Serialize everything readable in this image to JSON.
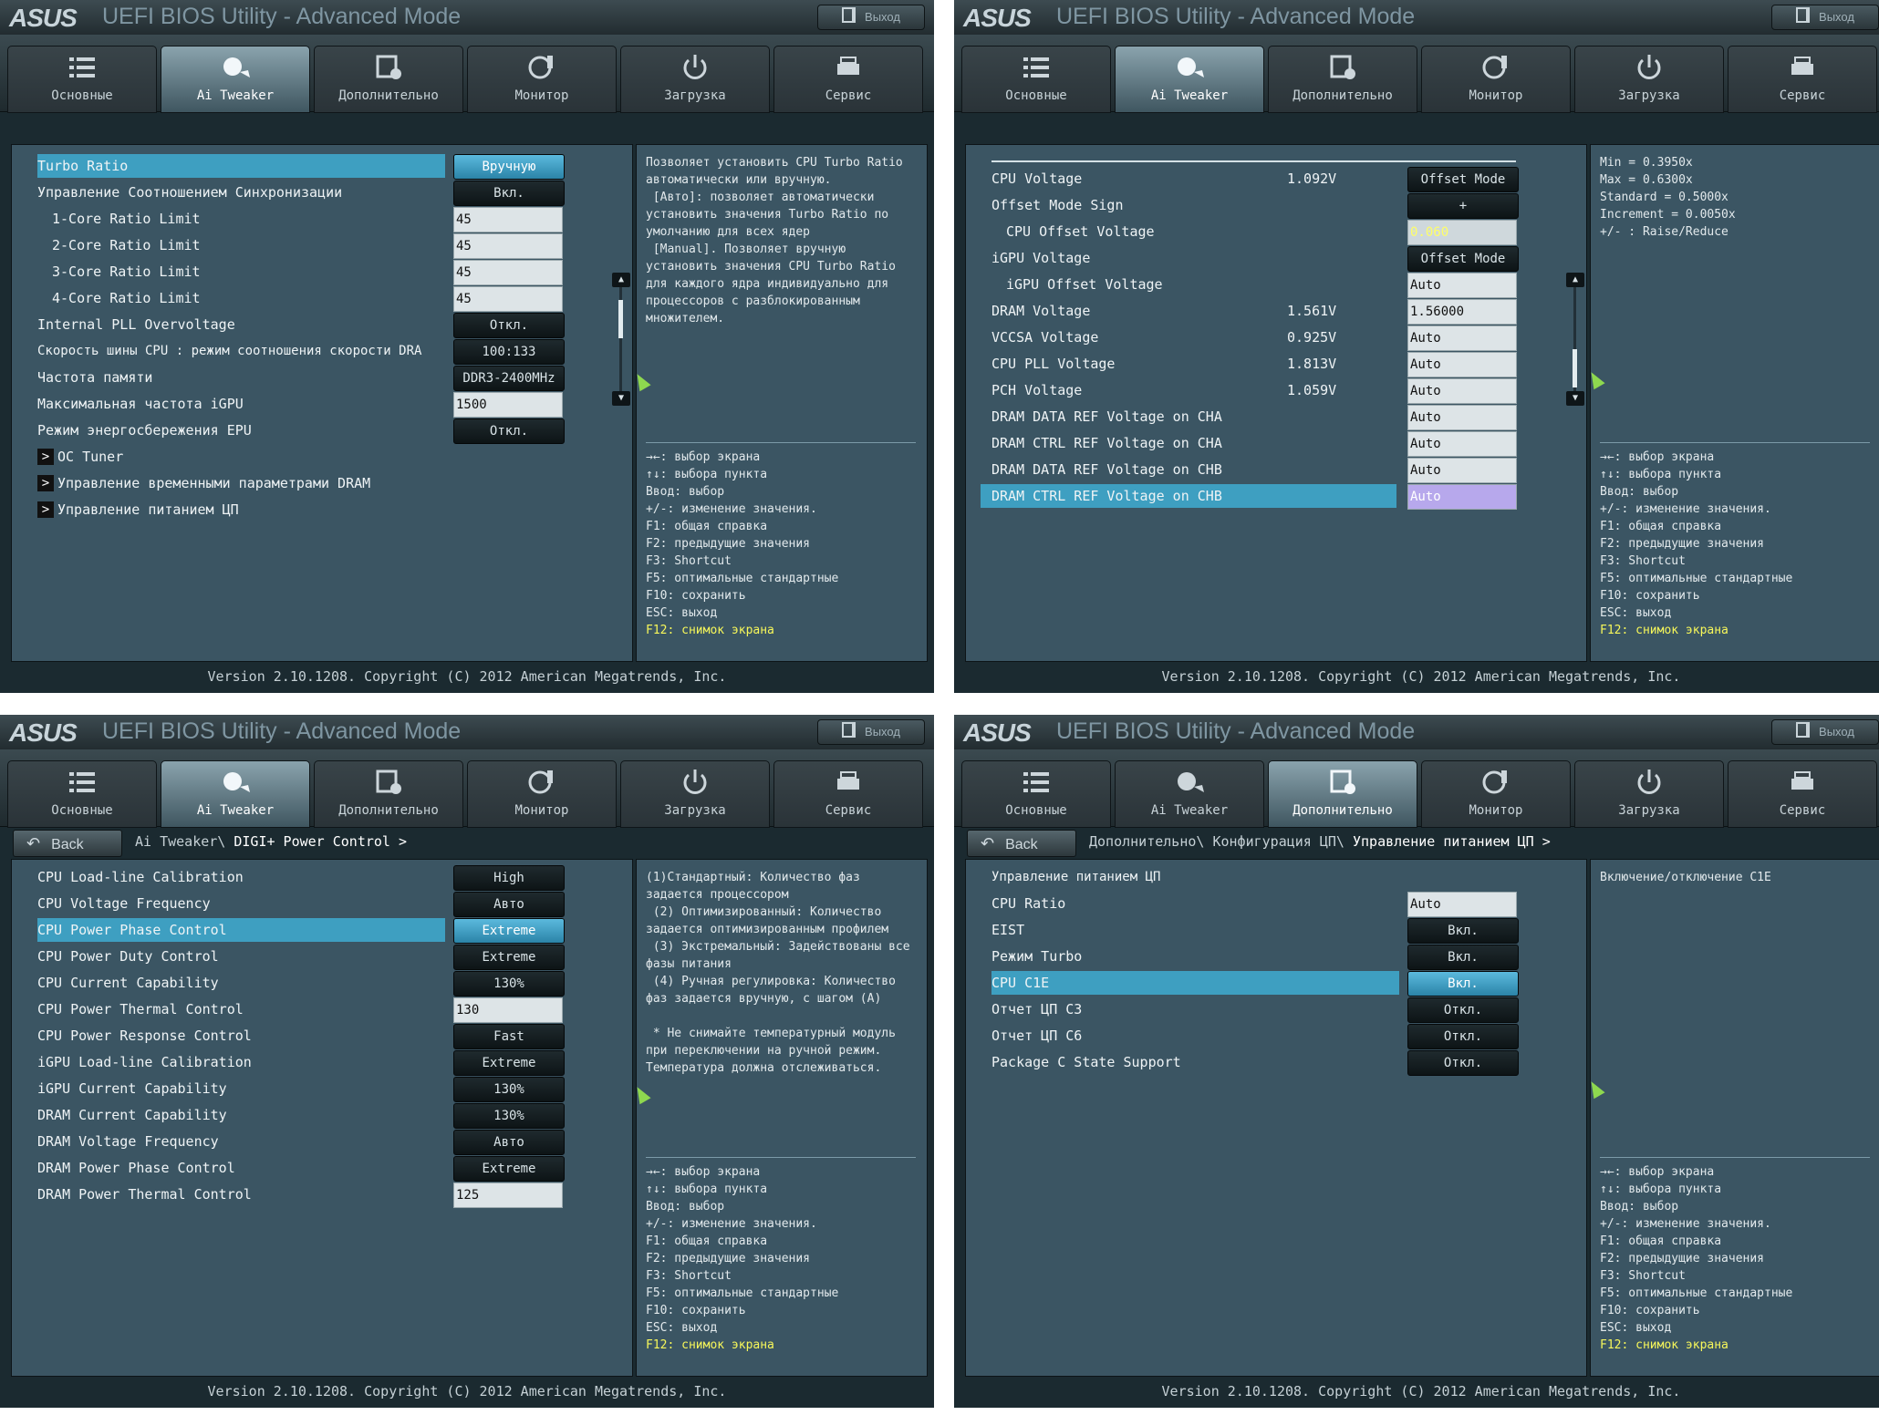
{
  "app": {
    "logo": "ASUS",
    "title": "UEFI BIOS Utility - Advanced Mode",
    "exit_label": "Выход",
    "footer": "Version 2.10.1208. Copyright (C) 2012 American Megatrends, Inc.",
    "back_label": "Back"
  },
  "tabs": [
    {
      "label": "Основные",
      "icon": "list-icon"
    },
    {
      "label": "Ai Tweaker",
      "icon": "fan-icon"
    },
    {
      "label": "Дополнительно",
      "icon": "settings-page-icon"
    },
    {
      "label": "Монитор",
      "icon": "gauge-icon"
    },
    {
      "label": "Загрузка",
      "icon": "power-icon"
    },
    {
      "label": "Сервис",
      "icon": "printer-icon"
    }
  ],
  "keys": [
    "→←: выбор экрана",
    "↑↓: выбора пункта",
    "Ввод: выбор",
    "+/-: изменение значения.",
    "F1: общая справка",
    "F2: предыдущие значения",
    "F3: Shortcut",
    "F5: оптимальные стандартные",
    "F10: сохранить",
    "ESC: выход",
    "F12: снимок экрана"
  ],
  "panel1": {
    "rows": [
      {
        "label": "Turbo Ratio",
        "value": "Вручную"
      },
      {
        "label": "Управление Соотношением Синхронизации",
        "value": "Вкл."
      },
      {
        "label": "1-Core Ratio Limit",
        "value": "45"
      },
      {
        "label": "2-Core Ratio Limit",
        "value": "45"
      },
      {
        "label": "3-Core Ratio Limit",
        "value": "45"
      },
      {
        "label": "4-Core Ratio Limit",
        "value": "45"
      },
      {
        "label": "Internal PLL Overvoltage",
        "value": "Откл."
      },
      {
        "label": "Скорость шины CPU : режим соотношения скорости DRA",
        "value": "100:133"
      },
      {
        "label": "Частота памяти",
        "value": "DDR3-2400MHz"
      },
      {
        "label": "Максимальная частота iGPU",
        "value": "1500"
      },
      {
        "label": "Режим энергосбережения EPU",
        "value": "Откл."
      },
      {
        "label": "OC Tuner"
      },
      {
        "label": "Управление временными параметрами DRAM"
      },
      {
        "label": "Управление питанием ЦП"
      }
    ],
    "help": "Позволяет установить CPU Turbo Ratio автоматически или вручную.\n [Авто]: позволяет автоматически установить значения Turbo Ratio по умолчанию для всех ядер\n [Manual]. Позволяет вручную установить значения CPU Turbo Ratio для каждого ядра индивидуально для процессоров с разблокированным множителем."
  },
  "panel2": {
    "rows": [
      {
        "label": "CPU Voltage",
        "measured": "1.092V",
        "value": "Offset Mode"
      },
      {
        "label": "Offset Mode Sign",
        "value": "+"
      },
      {
        "label": "CPU Offset Voltage",
        "value": "0.060"
      },
      {
        "label": "iGPU Voltage",
        "value": "Offset Mode"
      },
      {
        "label": "iGPU Offset Voltage",
        "value": "Auto"
      },
      {
        "label": "DRAM Voltage",
        "measured": "1.561V",
        "value": "1.56000"
      },
      {
        "label": "VCCSA Voltage",
        "measured": "0.925V",
        "value": "Auto"
      },
      {
        "label": "CPU PLL Voltage",
        "measured": "1.813V",
        "value": "Auto"
      },
      {
        "label": "PCH Voltage",
        "measured": "1.059V",
        "value": "Auto"
      },
      {
        "label": "DRAM DATA REF Voltage on CHA",
        "value": "Auto"
      },
      {
        "label": "DRAM CTRL REF Voltage on CHA",
        "value": "Auto"
      },
      {
        "label": "DRAM DATA REF Voltage on CHB",
        "value": "Auto"
      },
      {
        "label": "DRAM CTRL REF Voltage on CHB",
        "value": "Auto"
      }
    ],
    "help": "Min = 0.3950x\nMax = 0.6300x\nStandard = 0.5000x\nIncrement = 0.0050x\n+/- : Raise/Reduce"
  },
  "panel3": {
    "breadcrumb_path": "Ai Tweaker\\",
    "breadcrumb_current": "DIGI+ Power Control >",
    "rows": [
      {
        "label": "CPU Load-line Calibration",
        "value": "High"
      },
      {
        "label": "CPU Voltage Frequency",
        "value": "Авто"
      },
      {
        "label": "CPU Power Phase Control",
        "value": "Extreme"
      },
      {
        "label": "CPU Power Duty Control",
        "value": "Extreme"
      },
      {
        "label": "CPU Current Capability",
        "value": "130%"
      },
      {
        "label": "CPU Power Thermal Control",
        "value": "130"
      },
      {
        "label": "CPU Power Response Control",
        "value": "Fast"
      },
      {
        "label": "iGPU Load-line Calibration",
        "value": "Extreme"
      },
      {
        "label": "iGPU Current Capability",
        "value": "130%"
      },
      {
        "label": "DRAM Current Capability",
        "value": "130%"
      },
      {
        "label": "DRAM Voltage Frequency",
        "value": "Авто"
      },
      {
        "label": "DRAM Power Phase Control",
        "value": "Extreme"
      },
      {
        "label": "DRAM Power Thermal Control",
        "value": "125"
      }
    ],
    "help": "(1)Стандартный: Количество фаз задается процессором\n (2) Оптимизированный: Количество задается оптимизированным профилем\n (3) Экстремальный: Задействованы все фазы питания\n (4) Ручная регулировка: Количество фаз задается вручную, с шагом (А)\n\n * Не снимайте температурный модуль при переключении на ручной режим. Температура должна отслеживаться."
  },
  "panel4": {
    "breadcrumb_path": "Дополнительно\\ Конфигурация ЦП\\",
    "breadcrumb_current": "Управление питанием ЦП >",
    "rows": [
      {
        "label": "Управление питанием ЦП"
      },
      {
        "label": "CPU Ratio",
        "value": "Auto"
      },
      {
        "label": "EIST",
        "value": "Вкл."
      },
      {
        "label": "Режим Turbo",
        "value": "Вкл."
      },
      {
        "label": "CPU C1E",
        "value": "Вкл."
      },
      {
        "label": "Отчет ЦП C3",
        "value": "Откл."
      },
      {
        "label": "Отчет ЦП C6",
        "value": "Откл."
      },
      {
        "label": "Package C State Support",
        "value": "Откл."
      }
    ],
    "help": "Включение/отключение C1E"
  }
}
